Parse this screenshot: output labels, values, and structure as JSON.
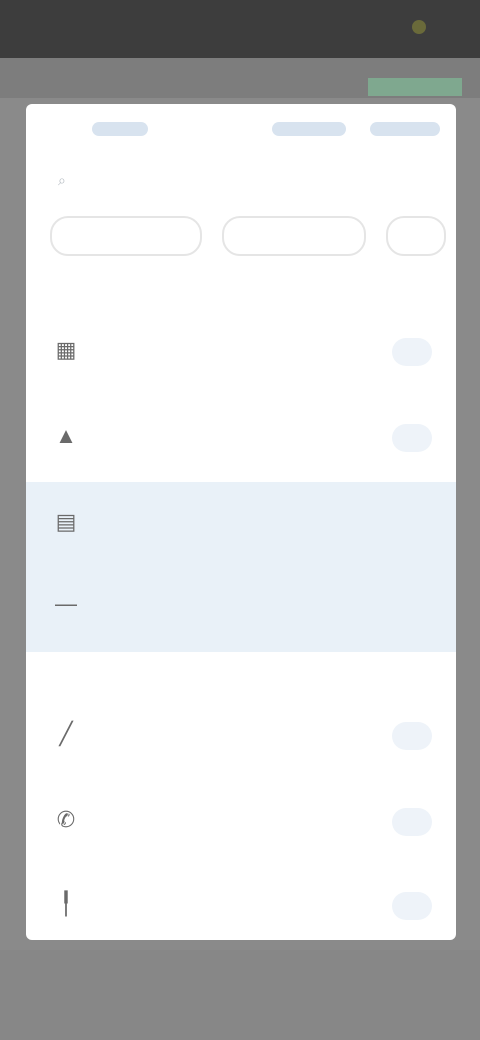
{
  "status_bar": {
    "time": "",
    "indicator": ""
  },
  "top_row": {
    "chips": [
      "",
      "",
      ""
    ]
  },
  "search": {
    "placeholder": ""
  },
  "tabs": [
    "",
    "",
    ""
  ],
  "sections": [
    {
      "label": "",
      "items": [
        {
          "title": "",
          "subtitle": "",
          "icon": "grid-icon",
          "action": ""
        },
        {
          "title": "",
          "subtitle": "",
          "icon": "person-icon",
          "action": ""
        },
        {
          "title": "",
          "subtitle": "",
          "icon": "document-icon",
          "action": ""
        },
        {
          "title": "",
          "subtitle": "",
          "icon": "dash-icon",
          "action": ""
        }
      ]
    },
    {
      "label": "",
      "items": [
        {
          "title": "",
          "subtitle": "",
          "icon": "pen-icon",
          "action": ""
        },
        {
          "title": "",
          "subtitle": "",
          "icon": "phone-icon",
          "action": ""
        },
        {
          "title": "",
          "subtitle": "",
          "icon": "pin-icon",
          "action": ""
        }
      ]
    }
  ],
  "colors": {
    "backdrop": "#8a8a8a",
    "highlight": "#e9f1f8",
    "accent": "#7fa88f"
  }
}
